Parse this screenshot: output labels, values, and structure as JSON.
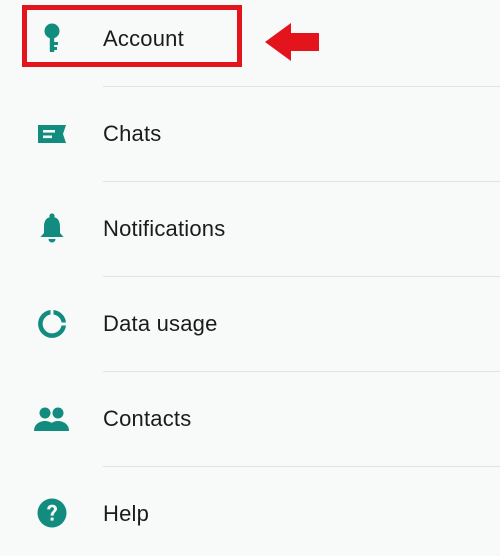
{
  "theme": {
    "accent": "#128c7e",
    "highlight": "#e3141c",
    "background": "#f7faf8",
    "divider": "#dfe3e1"
  },
  "settings": {
    "items": [
      {
        "label": "Account",
        "icon": "key-icon"
      },
      {
        "label": "Chats",
        "icon": "chat-icon"
      },
      {
        "label": "Notifications",
        "icon": "bell-icon"
      },
      {
        "label": "Data usage",
        "icon": "data-usage-icon"
      },
      {
        "label": "Contacts",
        "icon": "contacts-icon"
      },
      {
        "label": "Help",
        "icon": "help-icon"
      }
    ]
  },
  "annotation": {
    "highlighted_item": "Account",
    "arrow_direction": "left"
  }
}
